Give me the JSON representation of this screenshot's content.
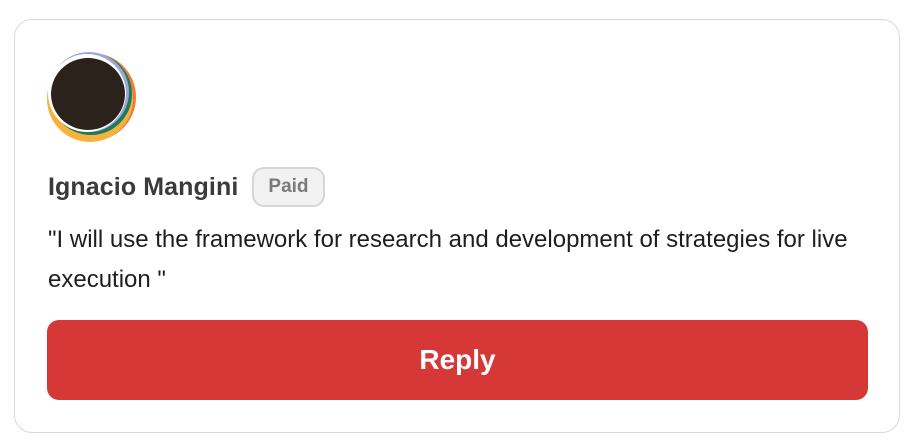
{
  "comment": {
    "author_name": "Ignacio Mangini",
    "badge": "Paid",
    "text": "\"I will use the framework for research and development of strategies for live execution \"",
    "avatar_icon": "user-avatar-icon"
  },
  "actions": {
    "reply_label": "Reply"
  },
  "colors": {
    "reply_button": "#d63737",
    "badge_background": "#f2f2f2",
    "card_border": "#d9d9d9"
  }
}
